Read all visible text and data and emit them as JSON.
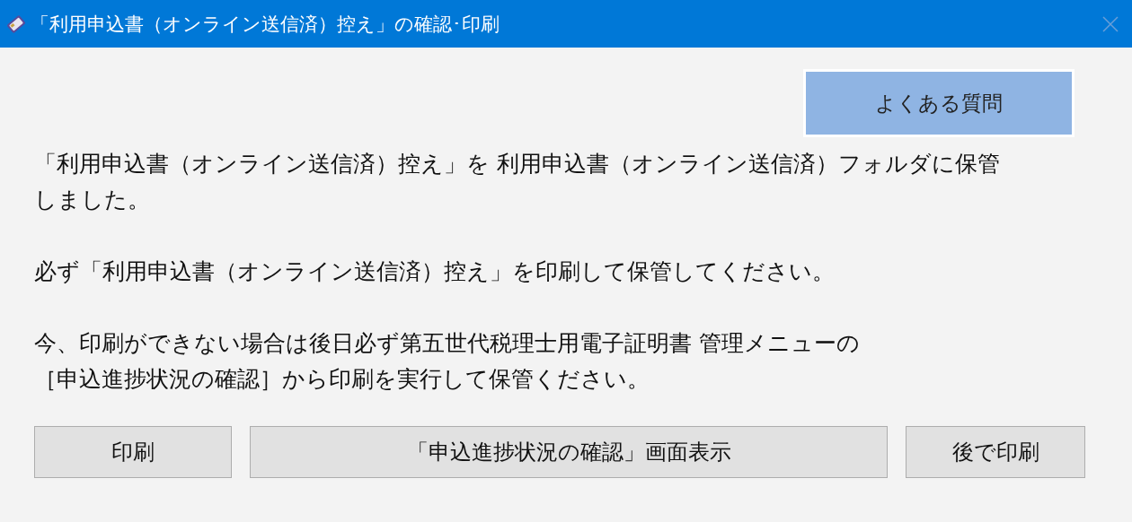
{
  "window": {
    "title": "「利用申込書（オンライン送信済）控え」の確認･印刷"
  },
  "faq_button": "よくある質問",
  "paragraphs": [
    {
      "lines": [
        "「利用申込書（オンライン送信済）控え」を 利用申込書（オンライン送信済）フォルダに保管",
        "しました。"
      ]
    },
    {
      "lines": [
        "必ず「利用申込書（オンライン送信済）控え」を印刷して保管してください。"
      ]
    },
    {
      "lines": [
        "今、印刷ができない場合は後日必ず第五世代税理士用電子証明書 管理メニューの",
        "［申込進捗状況の確認］から印刷を実行して保管ください。"
      ]
    }
  ],
  "buttons": [
    "印刷",
    "「申込進捗状況の確認」画面表示",
    "後で印刷"
  ]
}
